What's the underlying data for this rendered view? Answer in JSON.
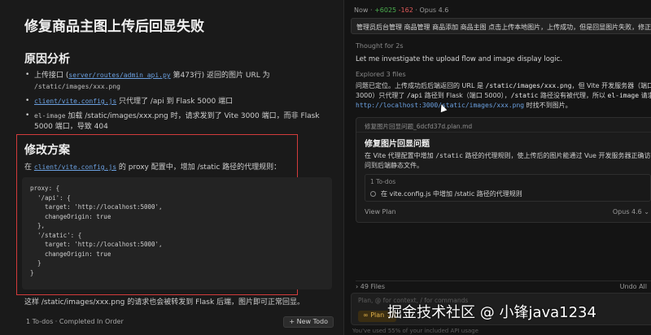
{
  "left": {
    "title": "修复商品主图上传后回显失败",
    "analysis_heading": "原因分析",
    "bullets": [
      {
        "pre": "上传接口 (",
        "link": "server/routes/admin_api.py",
        "post": " 第473行) 返回的图片 URL 为",
        "code2": "/static/images/xxx.png"
      },
      {
        "link": "client/vite.config.js",
        "post": " 只代理了 /api 到 Flask 5000 端口"
      },
      {
        "code": "el-image",
        "post": " 加载 /static/images/xxx.png 时，请求发到了 Vite 3000 端口，而非 Flask 5000 端口，导致 404"
      }
    ],
    "plan_heading": "修改方案",
    "plan_desc_pre": "在 ",
    "plan_desc_link": "client/vite.config.js",
    "plan_desc_post": " 的 proxy 配置中，增加 /static 路径的代理规则：",
    "code": "proxy: {\n  '/api': {\n    target: 'http://localhost:5000',\n    changeOrigin: true\n  },\n  '/static': {\n    target: 'http://localhost:5000',\n    changeOrigin: true\n  }\n}",
    "tail_text": "这样 /static/images/xxx.png 的请求也会被转发到 Flask 后端，图片即可正常回显。",
    "footer_status": "1 To-dos · Completed In Order",
    "new_todo_label": "+ New Todo"
  },
  "right": {
    "top_status_prefix": "Now · ",
    "top_add": "+6025",
    "top_del": "-162",
    "top_model": " · Opus 4.6",
    "prompt": "管理员后台管理 商品管理 商品添加 商品主图 点击上传本地图片，上传成功，但是回显图片失败，修正",
    "thought": "Thought for 2s",
    "investigate": "Let me investigate the upload flow and image display logic.",
    "explored": "Explored 3 files",
    "para_1": "问题已定位。上传成功后后端返回的 URL 是 ",
    "para_code1": "/static/images/xxx.png",
    "para_2": "，但 Vite 开发服务器（端口 3000）只代理了 ",
    "para_code2": "/api",
    "para_3": " 路径到 Flask（端口 5000），",
    "para_code3": "/static",
    "para_4": " 路径没有被代理，所以 ",
    "para_code4": "el-image",
    "para_5": " 请求 ",
    "para_url": "http://localhost:3000/static/images/xxx.png",
    "para_6": " 时找不到图片。",
    "card_file": "修复图片回显问题_6dcfd37d.plan.md",
    "card_title": "修复图片回显问题",
    "card_desc_1": "在 Vite 代理配置中增加 ",
    "card_desc_code": "/static",
    "card_desc_2": " 路径的代理规则，使上传后的图片能通过 Vue 开发服务器正确访问到后端静态文件。",
    "todo_label": "1 To-dos",
    "todo_item": "在 vite.config.js 中增加 /static 路径的代理规则",
    "view_plan": "View Plan",
    "opus": "Opus 4.6 ⌄",
    "files": "› 49 Files",
    "undo_all": "Undo All",
    "close": "✕",
    "input_placeholder": "Plan, @ for context, / for commands",
    "plan_btn": "∞ Plan ⌄",
    "bottom_status": "You've used 55% of your included API usage"
  },
  "watermark": "掘金技术社区 @ 小锋java1234"
}
